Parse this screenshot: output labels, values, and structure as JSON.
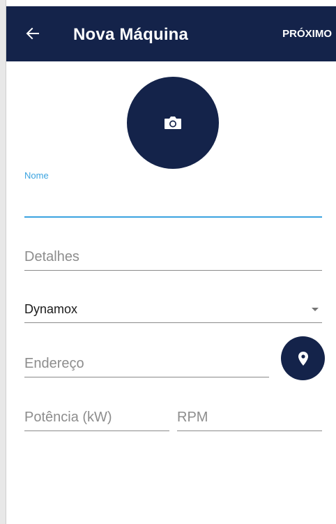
{
  "appbar": {
    "back_icon": "arrow-left-icon",
    "title": "Nova Máquina",
    "next_label": "PRÓXIMO",
    "background": "#14234a"
  },
  "photo": {
    "icon": "camera-icon"
  },
  "form": {
    "name": {
      "label": "Nome",
      "value": ""
    },
    "details": {
      "placeholder": "Detalhes",
      "value": ""
    },
    "company": {
      "value": "Dynamox",
      "icon": "dropdown-caret-icon"
    },
    "address": {
      "placeholder": "Endereço",
      "value": ""
    },
    "location_button": {
      "icon": "location-pin-icon"
    },
    "power": {
      "placeholder": "Potência (kW)",
      "value": ""
    },
    "rpm": {
      "placeholder": "RPM",
      "value": ""
    }
  },
  "colors": {
    "accent": "#3aa3e0",
    "primary": "#14234a"
  }
}
